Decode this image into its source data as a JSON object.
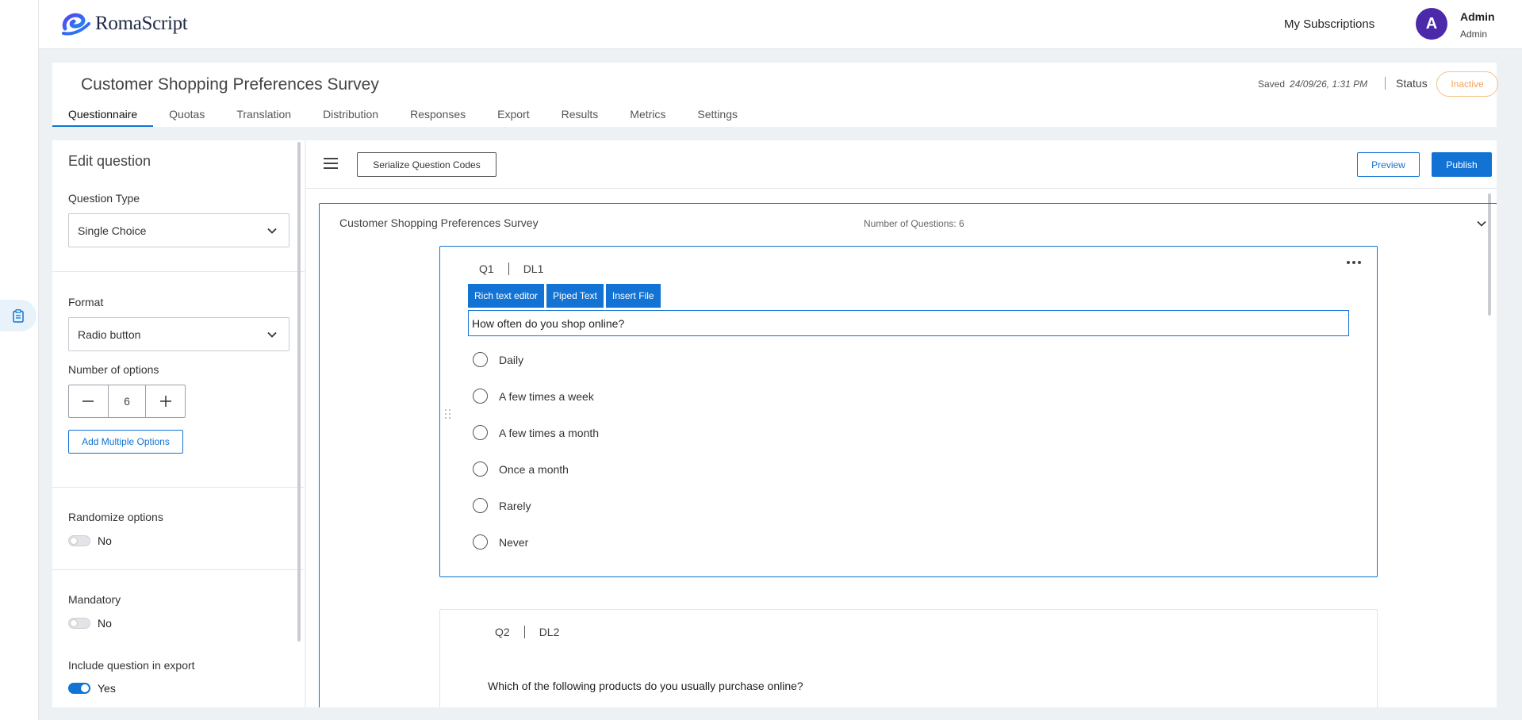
{
  "app": {
    "logo_text": "RomaScript",
    "my_subscriptions": "My Subscriptions",
    "user": {
      "initial": "A",
      "name": "Admin",
      "role": "Admin"
    }
  },
  "survey": {
    "title": "Customer Shopping Preferences Survey",
    "saved_label": "Saved",
    "saved_time": "24/09/26, 1:31 PM",
    "status_label": "Status",
    "status_value": "Inactive"
  },
  "tabs": [
    {
      "label": "Questionnaire",
      "active": true
    },
    {
      "label": "Quotas"
    },
    {
      "label": "Translation"
    },
    {
      "label": "Distribution"
    },
    {
      "label": "Responses"
    },
    {
      "label": "Export"
    },
    {
      "label": "Results"
    },
    {
      "label": "Metrics"
    },
    {
      "label": "Settings"
    }
  ],
  "edit_panel": {
    "title": "Edit question",
    "question_type_label": "Question Type",
    "question_type_value": "Single Choice",
    "format_label": "Format",
    "format_value": "Radio button",
    "num_options_label": "Number of options",
    "num_options_value": "6",
    "add_multiple_options": "Add Multiple Options",
    "randomize_label": "Randomize options",
    "randomize_value": "No",
    "mandatory_label": "Mandatory",
    "mandatory_value": "No",
    "include_export_label": "Include question in export",
    "include_export_value": "Yes"
  },
  "toolbar": {
    "serialize": "Serialize Question Codes",
    "preview": "Preview",
    "publish": "Publish"
  },
  "survey_box": {
    "title": "Customer Shopping Preferences Survey",
    "num_questions": "Number of Questions: 6"
  },
  "questions": [
    {
      "code": "Q1",
      "dl": "DL1",
      "editor_tabs": [
        "Rich text editor",
        "Piped Text",
        "Insert File"
      ],
      "text": "How often do you shop online?",
      "options": [
        "Daily",
        "A few times a week",
        "A few times a month",
        "Once a month",
        "Rarely",
        "Never"
      ]
    },
    {
      "code": "Q2",
      "dl": "DL2",
      "text": "Which of the following products do you usually purchase online?"
    }
  ],
  "colors": {
    "accent": "#1273d4",
    "avatar": "#4a2aa8",
    "inactive": "#f0a55c"
  },
  "icons": {
    "rail": "clipboard-icon",
    "select": "chevron-down-icon",
    "menu": "hamburger-icon",
    "more": "more-horizontal-icon",
    "drag": "drag-handle-icon"
  }
}
